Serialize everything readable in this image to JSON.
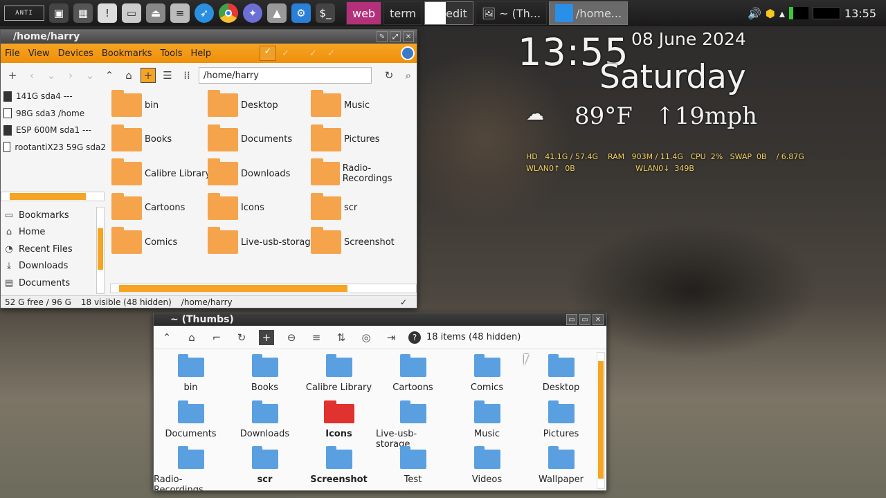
{
  "panel": {
    "logo": "ANTI",
    "tasks": [
      "web",
      "term",
      "edit",
      "~ (Th...",
      "/home..."
    ],
    "clock": "13:55"
  },
  "conky": {
    "time": "13:55",
    "date": "08 June 2024",
    "day": "Saturday",
    "weather": "89°F   ↑19mph",
    "stats_line1": "HD   41.1G / 57.4G    RAM   903M / 11.4G   CPU  2%   SWAP  0B    / 6.87G",
    "stats_line2": "WLAN0↑  0B                         WLAN0↓  349B"
  },
  "fm_window": {
    "title": "/home/harry",
    "menu": [
      "File",
      "View",
      "Devices",
      "Bookmarks",
      "Tools",
      "Help"
    ],
    "path": "/home/harry",
    "devices": [
      {
        "label": "141G sda4 ---",
        "hollow": false
      },
      {
        "label": "98G sda3 /home",
        "hollow": true
      },
      {
        "label": "ESP 600M sda1 ---",
        "hollow": false
      },
      {
        "label": "rootantiX23 59G sda2",
        "hollow": true
      }
    ],
    "places": [
      {
        "label": "Bookmarks",
        "icon": "▭"
      },
      {
        "label": "Home",
        "icon": "⌂"
      },
      {
        "label": "Recent Files",
        "icon": "◔"
      },
      {
        "label": "Downloads",
        "icon": "⤓"
      },
      {
        "label": "Documents",
        "icon": "▤"
      }
    ],
    "folders": [
      "bin",
      "Desktop",
      "Music",
      "Books",
      "Documents",
      "Pictures",
      "Calibre Library",
      "Downloads",
      "Radio-Recordings",
      "Cartoons",
      "Icons",
      "scr",
      "Comics",
      "Live-usb-storage",
      "Screenshot"
    ],
    "status_free": "52 G free / 96 G",
    "status_visible": "18 visible (48 hidden)",
    "status_path": "/home/harry"
  },
  "thumbs_window": {
    "title": "~ (Thumbs)",
    "items_count": "18 items (48 hidden)",
    "items": [
      {
        "label": "bin",
        "bold": false,
        "color": "blue"
      },
      {
        "label": "Books",
        "bold": false,
        "color": "blue"
      },
      {
        "label": "Calibre Library",
        "bold": false,
        "color": "blue"
      },
      {
        "label": "Cartoons",
        "bold": false,
        "color": "blue"
      },
      {
        "label": "Comics",
        "bold": false,
        "color": "blue"
      },
      {
        "label": "Desktop",
        "bold": false,
        "color": "blue"
      },
      {
        "label": "Documents",
        "bold": false,
        "color": "blue"
      },
      {
        "label": "Downloads",
        "bold": false,
        "color": "blue"
      },
      {
        "label": "Icons",
        "bold": true,
        "color": "red"
      },
      {
        "label": "Live-usb-storage",
        "bold": false,
        "color": "blue"
      },
      {
        "label": "Music",
        "bold": false,
        "color": "blue"
      },
      {
        "label": "Pictures",
        "bold": false,
        "color": "blue"
      },
      {
        "label": "Radio-Recordings",
        "bold": false,
        "color": "blue"
      },
      {
        "label": "scr",
        "bold": true,
        "color": "blue"
      },
      {
        "label": "Screenshot",
        "bold": true,
        "color": "blue"
      },
      {
        "label": "Test",
        "bold": false,
        "color": "blue"
      },
      {
        "label": "Videos",
        "bold": false,
        "color": "blue"
      },
      {
        "label": "Wallpaper",
        "bold": false,
        "color": "blue"
      }
    ]
  },
  "colors": {
    "accent": "#f6a423",
    "folder_orange": "#f5a44c",
    "folder_blue": "#5aa0e0",
    "folder_red": "#e0322e"
  }
}
